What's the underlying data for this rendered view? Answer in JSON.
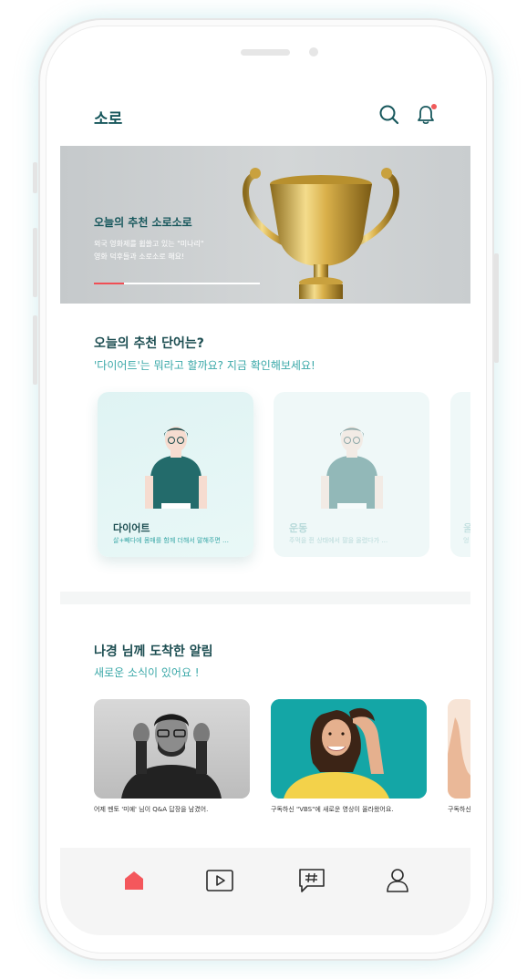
{
  "app": {
    "title": "소로"
  },
  "header": {
    "icons": [
      "search-icon",
      "bell-icon"
    ],
    "has_notification": true
  },
  "banner": {
    "title": "오늘의 추천 소로소로",
    "desc_line1": "외국 영화제를 휩쓸고 있는 \"미나리\"",
    "desc_line2": "영화 덕후들과 소로소로 해요!",
    "progress_fraction": 0.18
  },
  "recommend": {
    "title": "오늘의 추천 단어는?",
    "subtitle": "'다이어트'는 뭐라고 할까요? 지금 확인해보세요!",
    "cards": [
      {
        "word": "다이어트",
        "desc": "살+빼다에 몸매를 함께 더해서 말해주면 …",
        "active": true
      },
      {
        "word": "운동",
        "desc": "주먹을 쥔 상태에서 팔을 올렸다가 …",
        "active": false
      },
      {
        "word": "울",
        "desc": "엉",
        "active": false
      }
    ]
  },
  "notices": {
    "title": "나경 님께 도착한 알림",
    "subtitle": "새로운 소식이 있어요 !",
    "items": [
      {
        "caption": "어제 멘토 '미예' 님이 Q&A 답장을 남겼어."
      },
      {
        "caption": "구독하신 \"VBS\"에 새로운 영상이 올라왔어요."
      },
      {
        "caption": "구독하신"
      }
    ]
  },
  "tabbar": {
    "tabs": [
      {
        "name": "home",
        "icon": "home-icon",
        "active": true
      },
      {
        "name": "video",
        "icon": "play-icon",
        "active": false
      },
      {
        "name": "community",
        "icon": "hashtag-chat-icon",
        "active": false
      },
      {
        "name": "profile",
        "icon": "person-icon",
        "active": false
      }
    ]
  },
  "colors": {
    "brand": "#17575c",
    "accent_teal": "#3aa8a8",
    "alert_red": "#f05a5a"
  }
}
